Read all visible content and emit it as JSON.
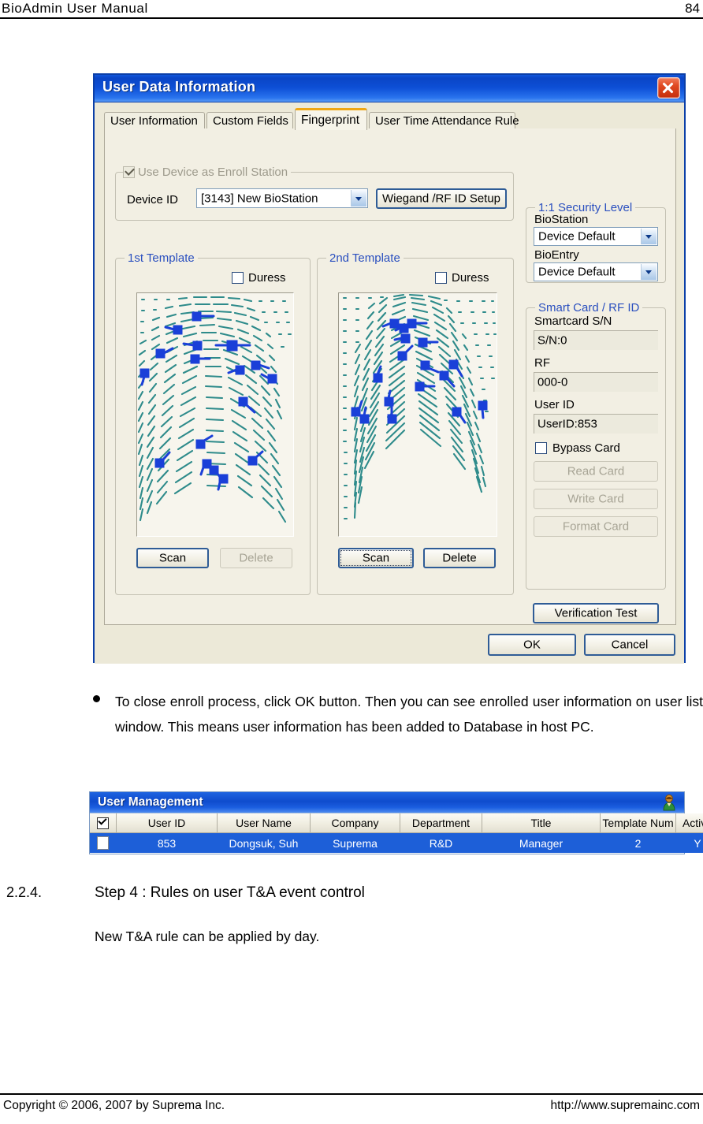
{
  "page": {
    "header_title": "BioAdmin  User  Manual",
    "page_number": "84",
    "footer_left": "Copyright © 2006, 2007 by Suprema Inc.",
    "footer_right": "http://www.supremainc.com"
  },
  "body": {
    "bullet": "To close enroll process, click OK button. Then you can see enrolled user information on user list window. This means user information has been added to Database in host PC.",
    "section_number": "2.2.4.",
    "section_title": "Step 4 : Rules on user T&A event control",
    "section_body": "New T&A rule can be applied by day."
  },
  "dialog": {
    "title": "User Data Information",
    "close_icon": "close-icon",
    "tabs": [
      {
        "label": "User Information",
        "active": false
      },
      {
        "label": "Custom Fields",
        "active": false
      },
      {
        "label": "Fingerprint",
        "active": true
      },
      {
        "label": "User Time Attendance Rule",
        "active": false
      }
    ],
    "enroll_station": {
      "group_title": "Use Device as Enroll Station",
      "checkbox_checked": true,
      "checkbox_enabled": false,
      "device_id_label": "Device ID",
      "device_id_value": "[3143] New BioStation",
      "wiegand_button": "Wiegand /RF ID Setup"
    },
    "template1": {
      "group_title": "1st Template",
      "duress_label": "Duress",
      "duress_checked": false,
      "scan_button": "Scan",
      "delete_button": "Delete",
      "delete_enabled": false,
      "scan_focused": false
    },
    "template2": {
      "group_title": "2nd Template",
      "duress_label": "Duress",
      "duress_checked": false,
      "scan_button": "Scan",
      "delete_button": "Delete",
      "delete_enabled": true,
      "scan_focused": true
    },
    "security_level": {
      "group_title": "1:1 Security Level",
      "biostation_label": "BioStation",
      "biostation_value": "Device Default",
      "bioentry_label": "BioEntry",
      "bioentry_value": "Device Default"
    },
    "smart_card": {
      "group_title": "Smart Card / RF ID",
      "smartcard_sn_label": "Smartcard S/N",
      "smartcard_sn_value": "S/N:0",
      "rf_label": "RF",
      "rf_value": "000-0",
      "user_id_label": "User ID",
      "user_id_value": "UserID:853",
      "bypass_label": "Bypass Card",
      "bypass_checked": false,
      "read_card": "Read Card",
      "write_card": "Write Card",
      "format_card": "Format Card",
      "card_buttons_enabled": false
    },
    "verification_test": "Verification Test",
    "ok_button": "OK",
    "cancel_button": "Cancel"
  },
  "user_management": {
    "title": "User Management",
    "title_icon": "person-icon",
    "columns": [
      "",
      "User ID",
      "User Name",
      "Company",
      "Department",
      "Title",
      "Template Num",
      "Active"
    ],
    "header_checkbox_checked": true,
    "rows": [
      {
        "selected": false,
        "user_id": "853",
        "user_name": "Dongsuk, Suh",
        "company": "Suprema",
        "department": "R&D",
        "title": "Manager",
        "template_num": "2",
        "active": "Y"
      }
    ]
  },
  "colors": {
    "titlebar_blue": "#0d4fd6",
    "accent_orange": "#f0a713",
    "group_label_blue": "#2a4fbf",
    "ridge_teal": "#2e8b8b",
    "minutia_blue": "#1a3fd8",
    "grid_row_blue": "#1d5fd8"
  }
}
